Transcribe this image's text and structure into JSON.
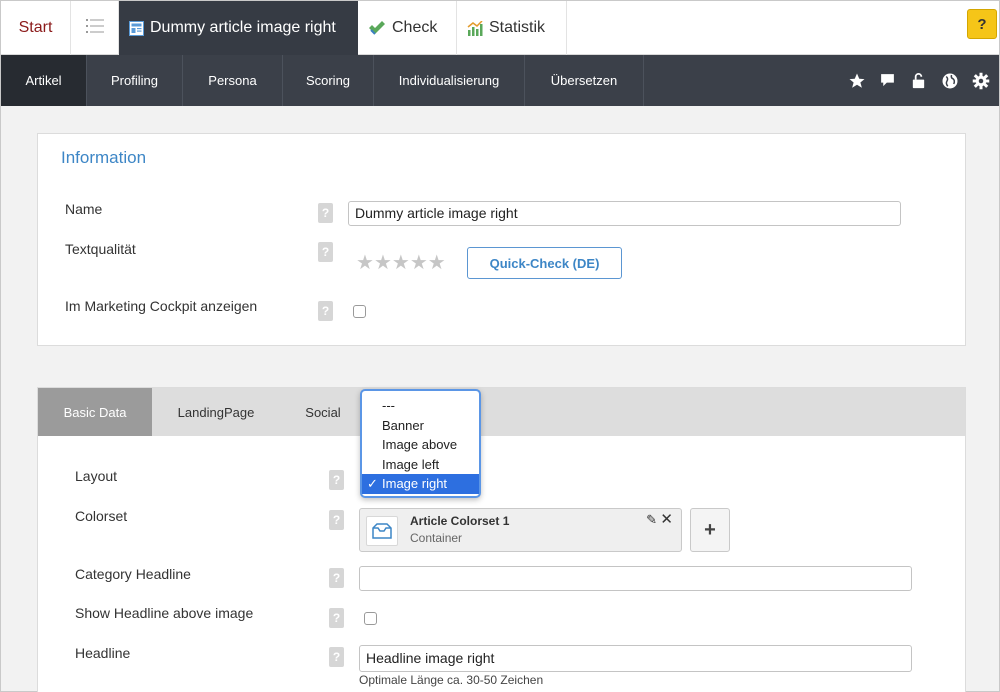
{
  "top_tabs": {
    "start": "Start",
    "article": "Dummy article image right",
    "check": "Check",
    "statistik": "Statistik",
    "help": "?"
  },
  "nav": {
    "items": [
      {
        "label": "Artikel",
        "active": true
      },
      {
        "label": "Profiling",
        "active": false
      },
      {
        "label": "Persona",
        "active": false
      },
      {
        "label": "Scoring",
        "active": false
      },
      {
        "label": "Individualisierung",
        "active": false
      },
      {
        "label": "Übersetzen",
        "active": false
      }
    ],
    "icons": [
      "star-icon",
      "comment-icon",
      "unlock-icon",
      "globe-icon",
      "gear-icon"
    ]
  },
  "information": {
    "title": "Information",
    "name_label": "Name",
    "name_value": "Dummy article image right",
    "textqualitaet_label": "Textqualität",
    "stars_filled": 0,
    "stars_total": 5,
    "quick_check_label": "Quick-Check (DE)",
    "marketing_label": "Im Marketing Cockpit anzeigen",
    "help_mark": "?"
  },
  "section_tabs": [
    {
      "label": "Basic Data",
      "active": true
    },
    {
      "label": "LandingPage",
      "active": false
    },
    {
      "label": "Social",
      "active": false
    }
  ],
  "layout_dropdown": {
    "options": [
      "---",
      "Banner",
      "Image above",
      "Image left",
      "Image right"
    ],
    "selected": "Image right",
    "check_mark": "✓"
  },
  "basic_data": {
    "layout_label": "Layout",
    "colorset_label": "Colorset",
    "colorset_title": "Article Colorset 1",
    "colorset_sub": "Container",
    "add_label": "+",
    "category_headline_label": "Category Headline",
    "category_headline_value": "",
    "show_headline_label": "Show Headline above image",
    "headline_label": "Headline",
    "headline_value": "Headline image right",
    "headline_hint": "Optimale Länge ca. 30-50 Zeichen"
  },
  "colors": {
    "accent": "#3d86c6",
    "nav_bg": "#3b4049",
    "help_yellow": "#f5c518",
    "selection": "#2d6fe0"
  }
}
